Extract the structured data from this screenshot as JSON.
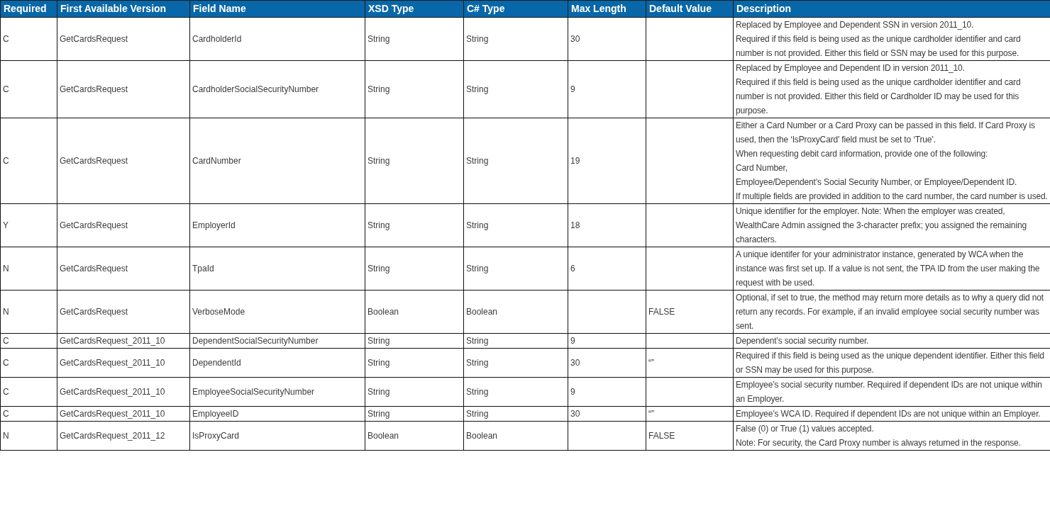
{
  "table": {
    "columns": [
      "Required",
      "First Available Version",
      "Field Name",
      "XSD Type",
      "C# Type",
      "Max Length",
      "Default Value",
      "Description"
    ],
    "rows": [
      {
        "required": "C",
        "version": "GetCardsRequest",
        "field_name": "CardholderId",
        "xsd_type": "String",
        "cs_type": "String",
        "max_length": "30",
        "description": [
          "Replaced by Employee and Dependent SSN in version 2011_10.",
          "Required if this field is being used as the unique cardholder identifier and card number is not provided. Either this field or SSN may be used for this purpose."
        ]
      },
      {
        "required": "C",
        "version": "GetCardsRequest",
        "field_name": "CardholderSocialSecurityNumber",
        "xsd_type": "String",
        "cs_type": "String",
        "max_length": "9",
        "description": [
          "Replaced by Employee and Dependent ID in version 2011_10.",
          "Required if this field is being used as the unique cardholder identifier and card number is not provided. Either this field or Cardholder ID may be used for this purpose."
        ]
      },
      {
        "required": "C",
        "version": "GetCardsRequest",
        "field_name": "CardNumber",
        "xsd_type": "String",
        "cs_type": "String",
        "max_length": "19",
        "description": [
          "Either a Card Number or a Card Proxy can be passed in this field.  If Card Proxy is used, then the ‘IsProxyCard’ field must be set to ‘True’.",
          "When requesting debit card information, provide one of the following:",
          "Card Number,",
          "Employee/Dependent’s Social Security Number, or Employee/Dependent ID.",
          "If multiple fields are provided in addition to the card number, the card number is used."
        ]
      },
      {
        "required": "Y",
        "version": "GetCardsRequest",
        "field_name": "EmployerId",
        "xsd_type": "String",
        "cs_type": "String",
        "max_length": "18",
        "description": [
          "Unique identifier for the employer. Note: When the employer was created, WealthCare Admin assigned the 3-character prefix; you assigned the remaining characters."
        ]
      },
      {
        "required": "N",
        "version": "GetCardsRequest",
        "field_name": "TpaId",
        "xsd_type": "String",
        "cs_type": "String",
        "max_length": "6",
        "description": [
          "A unique identifer for your administrator instance, generated by WCA when the instance was first set up. If a value is not sent, the TPA ID from the user making the request with be used."
        ]
      },
      {
        "required": "N",
        "version": "GetCardsRequest",
        "field_name": "VerboseMode",
        "xsd_type": "Boolean",
        "cs_type": "Boolean",
        "default_value": "FALSE",
        "description": [
          "Optional, if set to true, the method may return more details as to why a query did not return any records. For example, if an invalid employee social security number was sent."
        ]
      },
      {
        "required": "C",
        "version": "GetCardsRequest_2011_10",
        "field_name": "DependentSocialSecurityNumber",
        "xsd_type": "String",
        "cs_type": "String",
        "max_length": "9",
        "description": [
          "Dependent’s social security number."
        ]
      },
      {
        "required": "C",
        "version": "GetCardsRequest_2011_10",
        "field_name": "DependentId",
        "xsd_type": "String",
        "cs_type": "String",
        "max_length": "30",
        "default_value": "“”",
        "description": [
          "Required if this field is being used as the unique dependent identifier. Either this field or SSN may be used for this purpose."
        ]
      },
      {
        "required": "C",
        "version": "GetCardsRequest_2011_10",
        "field_name": "EmployeeSocialSecurityNumber",
        "xsd_type": "String",
        "cs_type": "String",
        "max_length": "9",
        "description": [
          "Employee’s social security number.  Required if dependent IDs are not unique within an Employer."
        ]
      },
      {
        "required": "C",
        "version": "GetCardsRequest_2011_10",
        "field_name": "EmployeeID",
        "xsd_type": "String",
        "cs_type": "String",
        "max_length": "30",
        "default_value": "“”",
        "description": [
          "Employee’s WCA ID.  Required if dependent IDs are not unique within an Employer."
        ]
      },
      {
        "required": "N",
        "version": "GetCardsRequest_2011_12",
        "field_name": "IsProxyCard",
        "xsd_type": "Boolean",
        "cs_type": "Boolean",
        "default_value": "FALSE",
        "description": [
          "False (0) or True (1) values accepted.",
          "Note: For security, the Card Proxy number is always returned in the response."
        ]
      }
    ]
  }
}
